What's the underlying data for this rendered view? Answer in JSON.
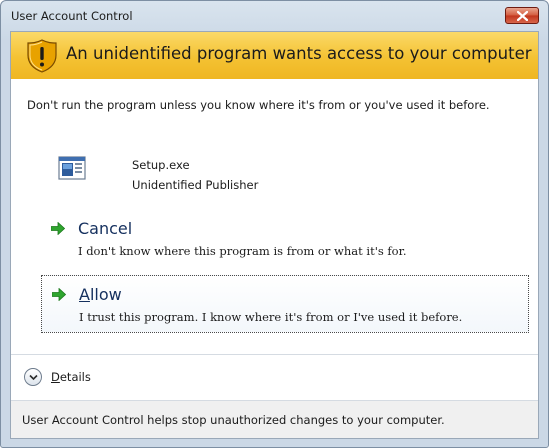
{
  "window": {
    "title": "User Account Control"
  },
  "banner": {
    "icon": "shield-warning-icon",
    "text": "An unidentified program wants access to your computer"
  },
  "warning": "Don't run the program unless you know where it's from or you've used it before.",
  "program": {
    "icon": "program-icon",
    "name": "Setup.exe",
    "publisher": "Unidentified Publisher"
  },
  "options": [
    {
      "icon": "green-arrow-icon",
      "title": "Cancel",
      "description": "I don't know where this program is from or what it's for."
    },
    {
      "icon": "green-arrow-icon",
      "title": "Allow",
      "description": "I trust this program. I know where it's from or I've used it before."
    }
  ],
  "details": {
    "icon": "chevron-down-icon",
    "label": "Details"
  },
  "footer": "User Account Control helps stop unauthorized changes to your computer.",
  "colors": {
    "banner": "#f4c233",
    "option_title": "#15305e",
    "arrow": "#2fa52f",
    "close_button": "#c2351c"
  }
}
